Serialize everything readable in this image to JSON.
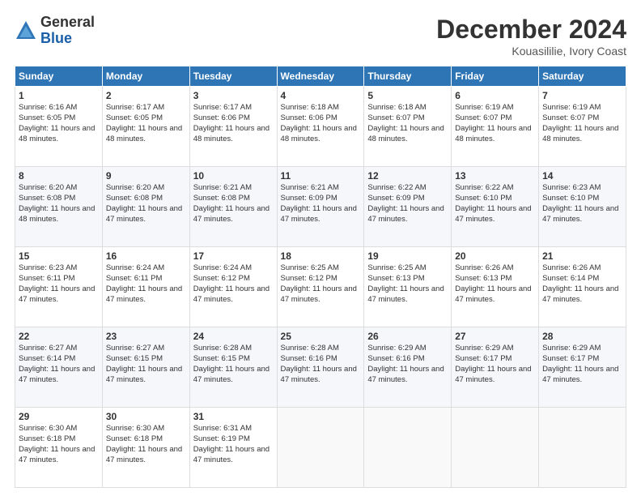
{
  "logo": {
    "general": "General",
    "blue": "Blue"
  },
  "title": "December 2024",
  "subtitle": "Kouasililie, Ivory Coast",
  "days": [
    "Sunday",
    "Monday",
    "Tuesday",
    "Wednesday",
    "Thursday",
    "Friday",
    "Saturday"
  ],
  "weeks": [
    [
      {
        "day": "1",
        "sunrise": "6:16 AM",
        "sunset": "6:05 PM",
        "daylight": "11 hours and 48 minutes."
      },
      {
        "day": "2",
        "sunrise": "6:17 AM",
        "sunset": "6:05 PM",
        "daylight": "11 hours and 48 minutes."
      },
      {
        "day": "3",
        "sunrise": "6:17 AM",
        "sunset": "6:06 PM",
        "daylight": "11 hours and 48 minutes."
      },
      {
        "day": "4",
        "sunrise": "6:18 AM",
        "sunset": "6:06 PM",
        "daylight": "11 hours and 48 minutes."
      },
      {
        "day": "5",
        "sunrise": "6:18 AM",
        "sunset": "6:07 PM",
        "daylight": "11 hours and 48 minutes."
      },
      {
        "day": "6",
        "sunrise": "6:19 AM",
        "sunset": "6:07 PM",
        "daylight": "11 hours and 48 minutes."
      },
      {
        "day": "7",
        "sunrise": "6:19 AM",
        "sunset": "6:07 PM",
        "daylight": "11 hours and 48 minutes."
      }
    ],
    [
      {
        "day": "8",
        "sunrise": "6:20 AM",
        "sunset": "6:08 PM",
        "daylight": "11 hours and 48 minutes."
      },
      {
        "day": "9",
        "sunrise": "6:20 AM",
        "sunset": "6:08 PM",
        "daylight": "11 hours and 47 minutes."
      },
      {
        "day": "10",
        "sunrise": "6:21 AM",
        "sunset": "6:08 PM",
        "daylight": "11 hours and 47 minutes."
      },
      {
        "day": "11",
        "sunrise": "6:21 AM",
        "sunset": "6:09 PM",
        "daylight": "11 hours and 47 minutes."
      },
      {
        "day": "12",
        "sunrise": "6:22 AM",
        "sunset": "6:09 PM",
        "daylight": "11 hours and 47 minutes."
      },
      {
        "day": "13",
        "sunrise": "6:22 AM",
        "sunset": "6:10 PM",
        "daylight": "11 hours and 47 minutes."
      },
      {
        "day": "14",
        "sunrise": "6:23 AM",
        "sunset": "6:10 PM",
        "daylight": "11 hours and 47 minutes."
      }
    ],
    [
      {
        "day": "15",
        "sunrise": "6:23 AM",
        "sunset": "6:11 PM",
        "daylight": "11 hours and 47 minutes."
      },
      {
        "day": "16",
        "sunrise": "6:24 AM",
        "sunset": "6:11 PM",
        "daylight": "11 hours and 47 minutes."
      },
      {
        "day": "17",
        "sunrise": "6:24 AM",
        "sunset": "6:12 PM",
        "daylight": "11 hours and 47 minutes."
      },
      {
        "day": "18",
        "sunrise": "6:25 AM",
        "sunset": "6:12 PM",
        "daylight": "11 hours and 47 minutes."
      },
      {
        "day": "19",
        "sunrise": "6:25 AM",
        "sunset": "6:13 PM",
        "daylight": "11 hours and 47 minutes."
      },
      {
        "day": "20",
        "sunrise": "6:26 AM",
        "sunset": "6:13 PM",
        "daylight": "11 hours and 47 minutes."
      },
      {
        "day": "21",
        "sunrise": "6:26 AM",
        "sunset": "6:14 PM",
        "daylight": "11 hours and 47 minutes."
      }
    ],
    [
      {
        "day": "22",
        "sunrise": "6:27 AM",
        "sunset": "6:14 PM",
        "daylight": "11 hours and 47 minutes."
      },
      {
        "day": "23",
        "sunrise": "6:27 AM",
        "sunset": "6:15 PM",
        "daylight": "11 hours and 47 minutes."
      },
      {
        "day": "24",
        "sunrise": "6:28 AM",
        "sunset": "6:15 PM",
        "daylight": "11 hours and 47 minutes."
      },
      {
        "day": "25",
        "sunrise": "6:28 AM",
        "sunset": "6:16 PM",
        "daylight": "11 hours and 47 minutes."
      },
      {
        "day": "26",
        "sunrise": "6:29 AM",
        "sunset": "6:16 PM",
        "daylight": "11 hours and 47 minutes."
      },
      {
        "day": "27",
        "sunrise": "6:29 AM",
        "sunset": "6:17 PM",
        "daylight": "11 hours and 47 minutes."
      },
      {
        "day": "28",
        "sunrise": "6:29 AM",
        "sunset": "6:17 PM",
        "daylight": "11 hours and 47 minutes."
      }
    ],
    [
      {
        "day": "29",
        "sunrise": "6:30 AM",
        "sunset": "6:18 PM",
        "daylight": "11 hours and 47 minutes."
      },
      {
        "day": "30",
        "sunrise": "6:30 AM",
        "sunset": "6:18 PM",
        "daylight": "11 hours and 47 minutes."
      },
      {
        "day": "31",
        "sunrise": "6:31 AM",
        "sunset": "6:19 PM",
        "daylight": "11 hours and 47 minutes."
      },
      null,
      null,
      null,
      null
    ]
  ],
  "labels": {
    "sunrise": "Sunrise:",
    "sunset": "Sunset:",
    "daylight": "Daylight:"
  }
}
